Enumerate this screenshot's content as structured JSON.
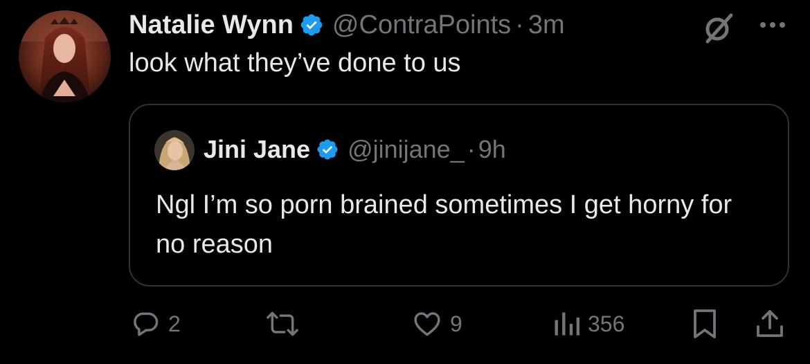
{
  "tweet": {
    "author": {
      "display_name": "Natalie Wynn",
      "verified": true,
      "handle": "@ContraPoints",
      "avatar_icon": "avatar-photo"
    },
    "separator": "·",
    "time": "3m",
    "text": "look what they’ve done to us",
    "icons": [
      "grok-icon",
      "more-icon"
    ]
  },
  "quoted": {
    "author": {
      "display_name": "Jini Jane",
      "verified": true,
      "handle": "@jinijane_",
      "avatar_icon": "avatar-photo"
    },
    "separator": "·",
    "time": "9h",
    "text": "Ngl I’m so porn brained sometimes I get horny for no reason"
  },
  "actions": {
    "replies": "2",
    "retweets": "",
    "likes": "9",
    "views": "356"
  },
  "colors": {
    "background": "#000000",
    "text_primary": "#e7e9ea",
    "text_secondary": "#71767b",
    "border": "#2f3336",
    "verified_badge": "#1d9bf0"
  }
}
